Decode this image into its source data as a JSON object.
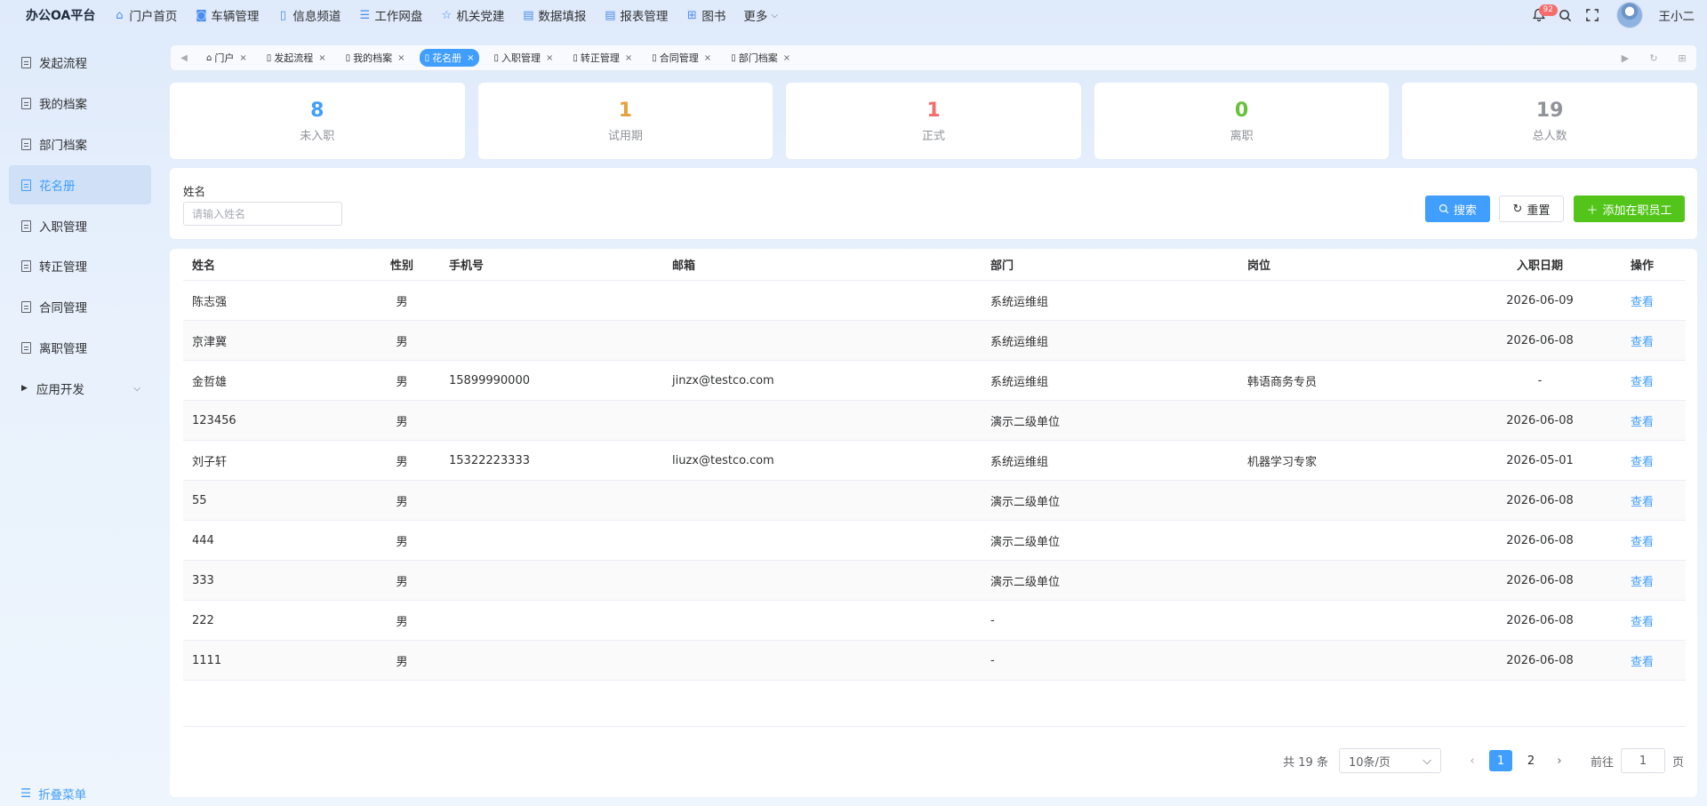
{
  "app": {
    "title": "办公OA平台"
  },
  "topnav": [
    {
      "label": "门户首页",
      "icon": "home-icon"
    },
    {
      "label": "车辆管理",
      "icon": "car-icon"
    },
    {
      "label": "信息频道",
      "icon": "book-icon"
    },
    {
      "label": "工作网盘",
      "icon": "database-icon"
    },
    {
      "label": "机关党建",
      "icon": "star-icon"
    },
    {
      "label": "数据填报",
      "icon": "document-icon"
    },
    {
      "label": "报表管理",
      "icon": "document-icon"
    },
    {
      "label": "图书",
      "icon": "grid-icon"
    },
    {
      "label": "更多",
      "icon": "chevron-down-icon"
    }
  ],
  "header": {
    "notification_count": "92",
    "user_name": "王小二"
  },
  "sidebar": {
    "items": [
      {
        "label": "发起流程"
      },
      {
        "label": "我的档案"
      },
      {
        "label": "部门档案"
      },
      {
        "label": "花名册"
      },
      {
        "label": "入职管理"
      },
      {
        "label": "转正管理"
      },
      {
        "label": "合同管理"
      },
      {
        "label": "离职管理"
      },
      {
        "label": "应用开发"
      }
    ],
    "active": "花名册",
    "collapse_label": "折叠菜单"
  },
  "tabs": [
    {
      "label": "门户",
      "icon": "home-icon"
    },
    {
      "label": "发起流程",
      "icon": "document-icon"
    },
    {
      "label": "我的档案",
      "icon": "document-icon"
    },
    {
      "label": "花名册",
      "icon": "document-icon"
    },
    {
      "label": "入职管理",
      "icon": "document-icon"
    },
    {
      "label": "转正管理",
      "icon": "document-icon"
    },
    {
      "label": "合同管理",
      "icon": "document-icon"
    },
    {
      "label": "部门档案",
      "icon": "document-icon"
    }
  ],
  "stats": [
    {
      "value": "8",
      "label": "未入职",
      "color": "#409eff"
    },
    {
      "value": "1",
      "label": "试用期",
      "color": "#e6a23c"
    },
    {
      "value": "1",
      "label": "正式",
      "color": "#f56c6c"
    },
    {
      "value": "0",
      "label": "离职",
      "color": "#67c23a"
    },
    {
      "value": "19",
      "label": "总人数",
      "color": "#909399"
    }
  ],
  "search": {
    "name_label": "姓名",
    "name_placeholder": "请输入姓名",
    "search_label": "搜索",
    "reset_label": "重置",
    "add_label": "添加在职员工"
  },
  "table": {
    "columns": [
      "姓名",
      "性别",
      "手机号",
      "邮箱",
      "部门",
      "岗位",
      "入职日期",
      "操作"
    ],
    "rows": [
      {
        "name": "陈志强",
        "sex": "男",
        "phone": "",
        "email": "",
        "dept": "系统运维组",
        "post": "",
        "date": "2026-06-09",
        "op": "查看"
      },
      {
        "name": "京津冀",
        "sex": "男",
        "phone": "",
        "email": "",
        "dept": "系统运维组",
        "post": "",
        "date": "2026-06-08",
        "op": "查看"
      },
      {
        "name": "金哲雄",
        "sex": "男",
        "phone": "15899990000",
        "email": "jinzx@testco.com",
        "dept": "系统运维组",
        "post": "韩语商务专员",
        "date": "-",
        "op": "查看"
      },
      {
        "name": "123456",
        "sex": "男",
        "phone": "",
        "email": "",
        "dept": "演示二级单位",
        "post": "",
        "date": "2026-06-08",
        "op": "查看"
      },
      {
        "name": "刘子轩",
        "sex": "男",
        "phone": "15322223333",
        "email": "liuzx@testco.com",
        "dept": "系统运维组",
        "post": "机器学习专家",
        "date": "2026-05-01",
        "op": "查看"
      },
      {
        "name": "55",
        "sex": "男",
        "phone": "",
        "email": "",
        "dept": "演示二级单位",
        "post": "",
        "date": "2026-06-08",
        "op": "查看"
      },
      {
        "name": "444",
        "sex": "男",
        "phone": "",
        "email": "",
        "dept": "演示二级单位",
        "post": "",
        "date": "2026-06-08",
        "op": "查看"
      },
      {
        "name": "333",
        "sex": "男",
        "phone": "",
        "email": "",
        "dept": "演示二级单位",
        "post": "",
        "date": "2026-06-08",
        "op": "查看"
      },
      {
        "name": "222",
        "sex": "男",
        "phone": "",
        "email": "",
        "dept": "-",
        "post": "",
        "date": "2026-06-08",
        "op": "查看"
      },
      {
        "name": "1111",
        "sex": "男",
        "phone": "",
        "email": "",
        "dept": "-",
        "post": "",
        "date": "2026-06-08",
        "op": "查看"
      }
    ]
  },
  "pagination": {
    "total_text": "共 19 条",
    "page_size": "10条/页",
    "pages": [
      "1",
      "2"
    ],
    "current": "1",
    "goto_label": "前往",
    "goto_value": "1",
    "page_word": "页"
  }
}
